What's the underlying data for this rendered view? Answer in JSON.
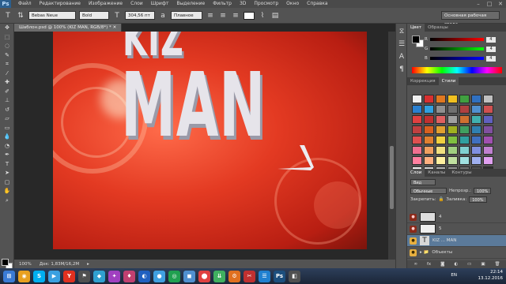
{
  "app": {
    "logo": "Ps",
    "menu": [
      "Файл",
      "Редактирование",
      "Изображение",
      "Слои",
      "Шрифт",
      "Выделение",
      "Фильтр",
      "3D",
      "Просмотр",
      "Окно",
      "Справка"
    ]
  },
  "options": {
    "font_family": "Bebas Neue",
    "font_style": "Bold",
    "font_size": "304,56 пт",
    "antialias": "Плавное",
    "workspace": "Основная рабочая среда"
  },
  "document": {
    "tab_title": "Шаблон.psd @ 100% (KIZ MAN, RGB/8*) *",
    "art_top_text": "KIZ",
    "art_main_text": "MAN",
    "zoom": "100%",
    "doc_info": "Док: 1,83M/16,2M"
  },
  "color_panel": {
    "tabs": [
      "Цвет",
      "Образцы"
    ],
    "rows": [
      {
        "label": "R",
        "value": "4"
      },
      {
        "label": "G",
        "value": "4"
      },
      {
        "label": "B",
        "value": "4"
      }
    ]
  },
  "styles_panel": {
    "tabs": [
      "Коррекция",
      "Стили"
    ],
    "swatches": [
      "#f0f0f0",
      "#d83030",
      "#e07820",
      "#f0c020",
      "#40a040",
      "#3070c0",
      "#c0c0c0",
      "#2a80d0",
      "#30a0e0",
      "#909090",
      "#707070",
      "#b04040",
      "#5090d0",
      "#d05050",
      "#e04040",
      "#c03030",
      "#e06060",
      "#a0a0a0",
      "#d07030",
      "#40b0b0",
      "#6060c0",
      "#c04040",
      "#d86020",
      "#e0a030",
      "#a0b020",
      "#40a060",
      "#3080b0",
      "#8050a0",
      "#e05050",
      "#e08030",
      "#f0d040",
      "#80c040",
      "#30a0a0",
      "#4070c0",
      "#a050b0",
      "#f07090",
      "#f0a060",
      "#f0e080",
      "#a0d080",
      "#80d0d0",
      "#8090e0",
      "#c080d0",
      "#ff80a0",
      "#ffb080",
      "#fff0a0",
      "#c0e0a0",
      "#a0e0e0",
      "#a0b0f0",
      "#e0a0f0",
      "#f0f0f0",
      "#d0d0d0",
      "#b0b0b0",
      "#909090",
      "#707070",
      "#505050",
      "#303030"
    ]
  },
  "layers_panel": {
    "tabs": [
      "Слои",
      "Каналы",
      "Контуры"
    ],
    "filter": "Вид",
    "blend": "Обычные",
    "opacity_label": "Непрозр.:",
    "opacity": "100%",
    "lock_label": "Закрепить:",
    "fill_label": "Заливка:",
    "fill": "100%",
    "layers": [
      {
        "name": "4",
        "eye": "●",
        "selected": false
      },
      {
        "name": "5",
        "eye": "●",
        "selected": false
      },
      {
        "name": "KIZ ... MAN",
        "eye": "●",
        "selected": true
      },
      {
        "name": "Объекты",
        "eye": "●",
        "selected": false
      }
    ]
  },
  "taskbar": {
    "icons": [
      {
        "glyph": "⊞",
        "color": "#3a7bd5"
      },
      {
        "glyph": "◉",
        "color": "#e8a020"
      },
      {
        "glyph": "S",
        "color": "#00aff0"
      },
      {
        "glyph": "▶",
        "color": "#3aa0e0"
      },
      {
        "glyph": "Y",
        "color": "#e03020"
      },
      {
        "glyph": "⚑",
        "color": "#505050"
      },
      {
        "glyph": "◆",
        "color": "#30a0d0"
      },
      {
        "glyph": "✦",
        "color": "#a040c0"
      },
      {
        "glyph": "♦",
        "color": "#c04070"
      },
      {
        "glyph": "◐",
        "color": "#2060c0"
      },
      {
        "glyph": "●",
        "color": "#40a0e0"
      },
      {
        "glyph": "◎",
        "color": "#20a050"
      },
      {
        "glyph": "◼",
        "color": "#5090d0"
      },
      {
        "glyph": "⬤",
        "color": "#e04040"
      },
      {
        "glyph": "⇊",
        "color": "#40b060"
      },
      {
        "glyph": "⚙",
        "color": "#e07020"
      },
      {
        "glyph": "✂",
        "color": "#c03030"
      },
      {
        "glyph": "☰",
        "color": "#2080d0"
      },
      {
        "glyph": "Ps",
        "color": "#1c4f7e"
      },
      {
        "glyph": "◧",
        "color": "#505050"
      }
    ],
    "lang": "EN",
    "time": "22:14",
    "date": "13.12.2016"
  }
}
